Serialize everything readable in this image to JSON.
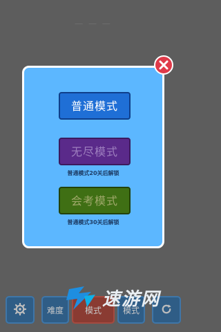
{
  "background": {
    "title": "一 一 一",
    "bottom_bar": {
      "difficulty_label": "难度",
      "mode_label": "模式",
      "mode2_label": "模式"
    }
  },
  "modal": {
    "options": [
      {
        "label": "普通模式",
        "locked": false
      },
      {
        "label": "无尽模式",
        "locked": true,
        "unlock_hint": "普通模式20关后解锁"
      },
      {
        "label": "会考模式",
        "locked": true,
        "unlock_hint": "普通模式30关后解锁"
      }
    ]
  },
  "watermark": {
    "text": "速游网"
  },
  "colors": {
    "modal_bg": "#5cb7ff",
    "normal_button": "#1f6fd6",
    "endless_button": "#5a2a8a",
    "exam_button": "#3f6f14",
    "close_button": "#e03a4a"
  },
  "icons": {
    "close": "close-icon",
    "settings": "gear-icon",
    "refresh": "refresh-icon"
  }
}
